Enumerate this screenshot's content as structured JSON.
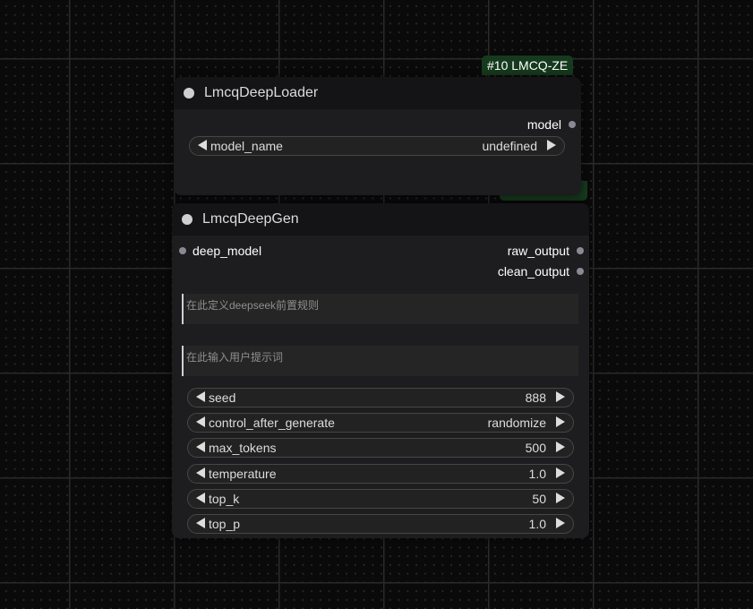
{
  "canvas": {
    "background_color": "#0a0a0a",
    "grid_color": "#2a2a2a",
    "badge_color": "#163a1d"
  },
  "loader_node": {
    "badge": "#10 LMCQ-ZE",
    "title": "LmcqDeepLoader",
    "outputs": [
      "model"
    ],
    "widgets": [
      {
        "label": "model_name",
        "value": "undefined"
      }
    ]
  },
  "gen_node": {
    "title": "LmcqDeepGen",
    "inputs": [
      "deep_model"
    ],
    "outputs": [
      "raw_output",
      "clean_output"
    ],
    "system_prompt_placeholder": "在此定义deepseek前置规则",
    "user_prompt_placeholder": "在此输入用户提示词",
    "widgets": [
      {
        "label": "seed",
        "value": "888"
      },
      {
        "label": "control_after_generate",
        "value": "randomize"
      },
      {
        "label": "max_tokens",
        "value": "500"
      },
      {
        "label": "temperature",
        "value": "1.0"
      },
      {
        "label": "top_k",
        "value": "50"
      },
      {
        "label": "top_p",
        "value": "1.0"
      }
    ]
  }
}
